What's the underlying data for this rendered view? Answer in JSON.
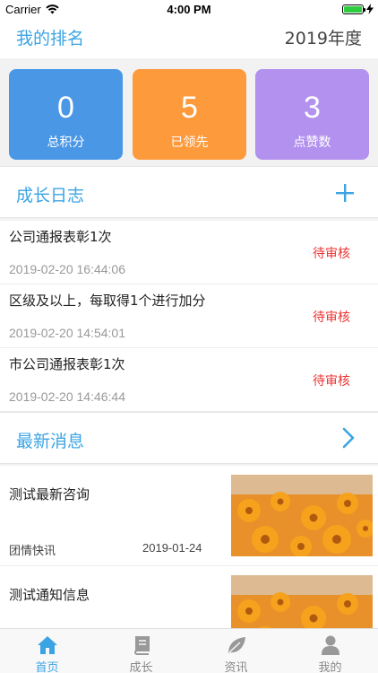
{
  "status_bar": {
    "carrier": "Carrier",
    "time": "4:00 PM"
  },
  "header": {
    "title": "我的排名",
    "year": "2019年度"
  },
  "stats": [
    {
      "value": "0",
      "label": "总积分",
      "color": "#4a97e6"
    },
    {
      "value": "5",
      "label": "已领先",
      "color": "#fd9a3c"
    },
    {
      "value": "3",
      "label": "点赞数",
      "color": "#b291ef"
    }
  ],
  "growth_log": {
    "title": "成长日志",
    "add_icon": "plus-icon",
    "items": [
      {
        "text": "公司通报表彰1次",
        "time": "2019-02-20 16:44:06",
        "status": "待审核"
      },
      {
        "text": "区级及以上，每取得1个进行加分",
        "time": "2019-02-20 14:54:01",
        "status": "待审核"
      },
      {
        "text": "市公司通报表彰1次",
        "time": "2019-02-20 14:46:44",
        "status": "待审核"
      }
    ]
  },
  "news": {
    "title": "最新消息",
    "more_icon": "chevron-right-icon",
    "items": [
      {
        "title": "测试最新咨询",
        "category": "团情快讯",
        "date": "2019-01-24",
        "image": "orange-flowers-photo"
      },
      {
        "title": "测试通知信息",
        "category": "",
        "date": "",
        "image": "orange-flowers-photo"
      }
    ]
  },
  "tabbar": {
    "items": [
      {
        "label": "首页",
        "icon": "home-icon",
        "active": true
      },
      {
        "label": "成长",
        "icon": "book-icon",
        "active": false
      },
      {
        "label": "资讯",
        "icon": "leaf-icon",
        "active": false
      },
      {
        "label": "我的",
        "icon": "user-icon",
        "active": false
      }
    ]
  },
  "colors": {
    "accent": "#3ba4e4",
    "pending": "#e33333"
  }
}
